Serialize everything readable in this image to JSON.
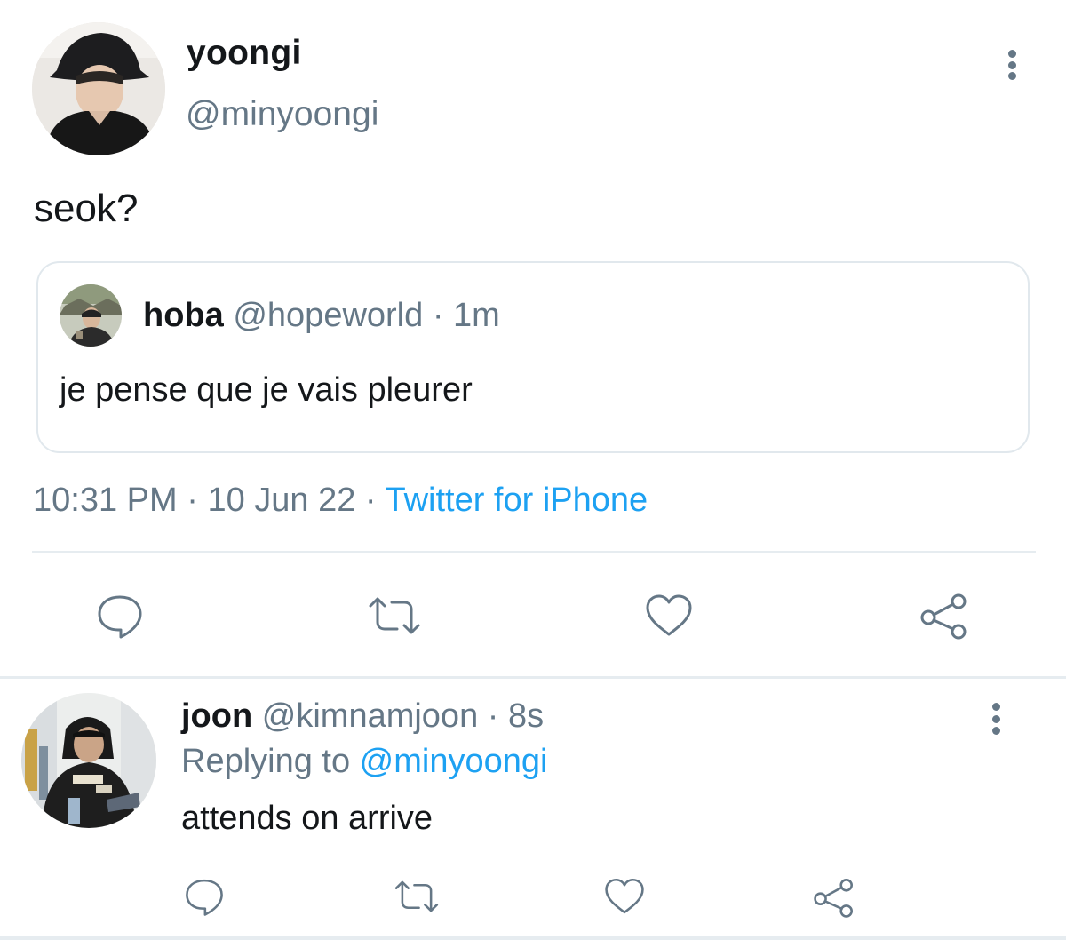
{
  "main_tweet": {
    "author_name": "yoongi",
    "author_handle": "@minyoongi",
    "text": "seok?",
    "quote": {
      "name": "hoba",
      "handle": "@hopeworld",
      "separator": " · ",
      "age": "1m",
      "text": "je pense que je vais pleurer"
    },
    "time": "10:31 PM",
    "separator": " · ",
    "date": "10 Jun 22",
    "source": "Twitter for iPhone",
    "actions": [
      "reply-icon",
      "retweet-icon",
      "like-icon",
      "share-icon"
    ]
  },
  "reply_tweet": {
    "author_name": "joon",
    "author_handle": "@kimnamjoon",
    "separator": " · ",
    "age": "8s",
    "replying_prefix": "Replying to ",
    "replying_to": "@minyoongi",
    "text": "attends on arrive",
    "actions": [
      "reply-icon",
      "retweet-icon",
      "like-icon",
      "share-icon"
    ]
  },
  "colors": {
    "text": "#14171a",
    "secondary": "#657786",
    "link": "#1da1f2",
    "border": "#e1e8ed"
  }
}
